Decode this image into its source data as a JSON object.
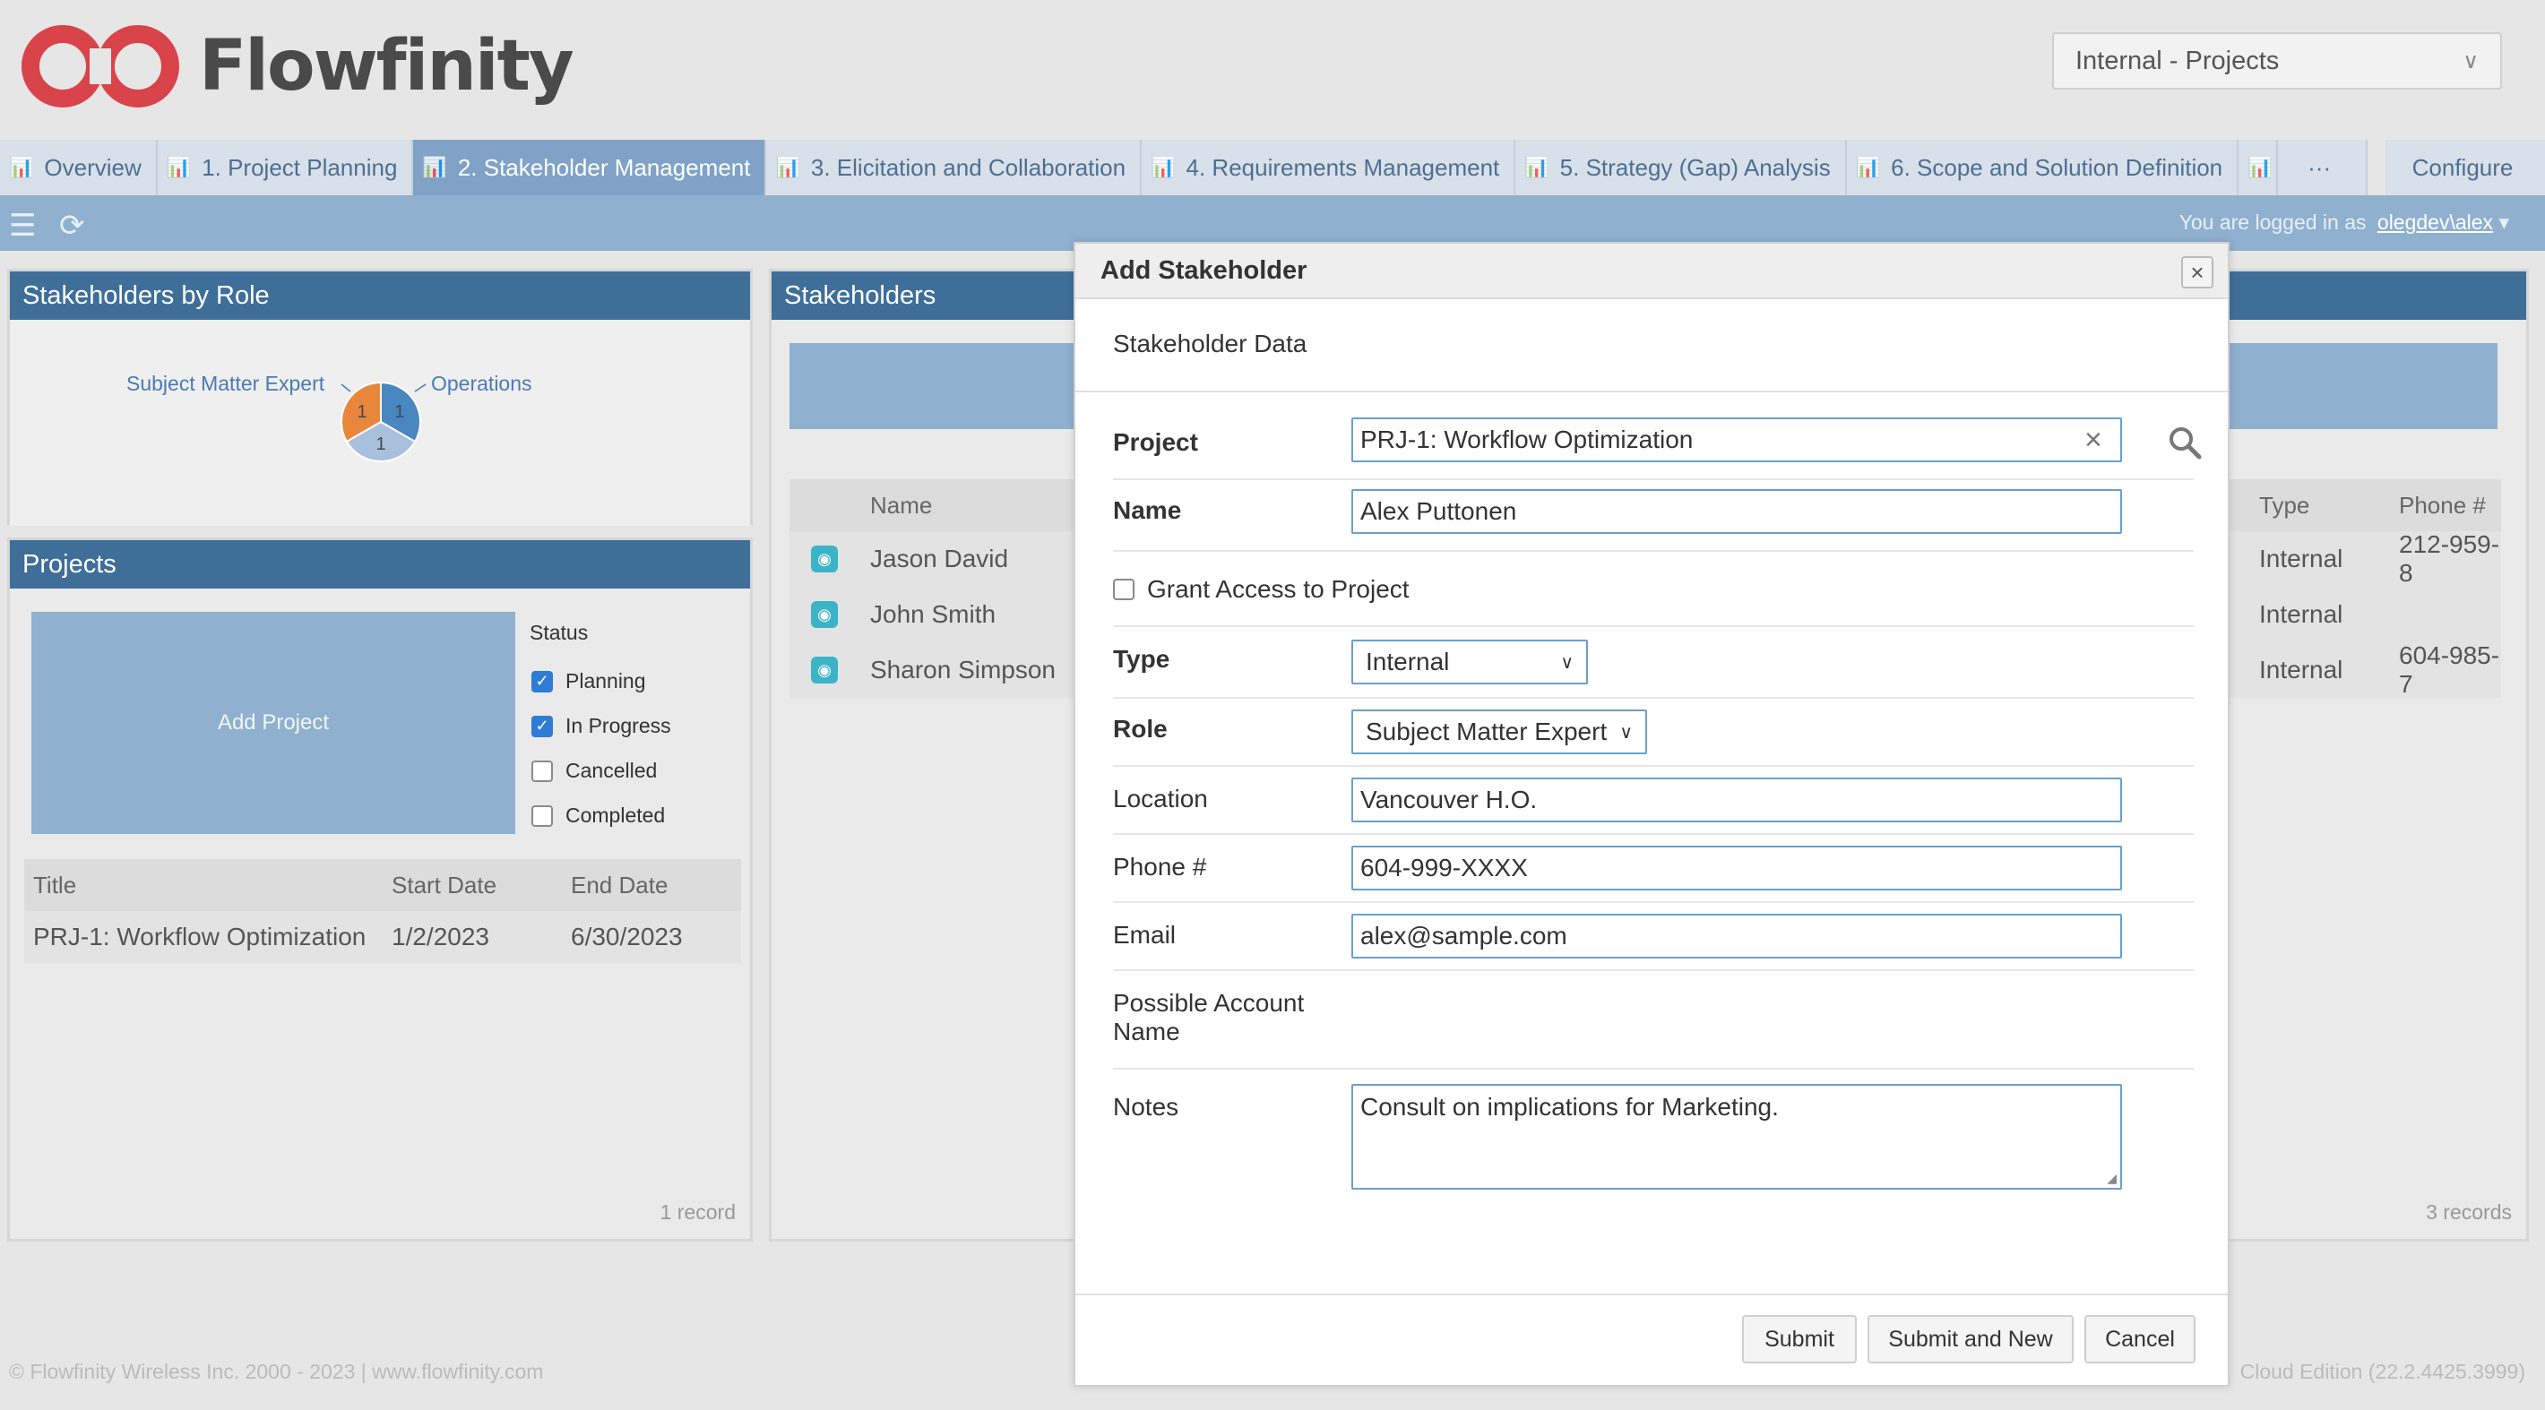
{
  "brand": {
    "name": "Flowfinity",
    "logo_color": "#d9434a"
  },
  "app_select": {
    "value": "Internal - Projects"
  },
  "tabs": [
    {
      "label": "Overview"
    },
    {
      "label": "1. Project Planning"
    },
    {
      "label": "2. Stakeholder Management",
      "active": true
    },
    {
      "label": "3. Elicitation and Collaboration"
    },
    {
      "label": "4. Requirements Management"
    },
    {
      "label": "5. Strategy (Gap) Analysis"
    },
    {
      "label": "6. Scope and Solution Definition"
    }
  ],
  "tabs_more": "···",
  "tabs_configure": "Configure",
  "toolbar": {
    "logged_prefix": "You are logged in as",
    "user": "olegdev\\alex"
  },
  "role_panel": {
    "title": "Stakeholders by Role",
    "chart_data": {
      "type": "pie",
      "slices": [
        {
          "label": "Subject Matter Expert",
          "value": 1,
          "color": "#e8873b"
        },
        {
          "label": "Operations",
          "value": 1,
          "color": "#4a86bf"
        },
        {
          "label": "",
          "value": 1,
          "color": "#a9c0dc"
        }
      ]
    }
  },
  "projects_panel": {
    "title": "Projects",
    "add_label": "Add Project",
    "status_title": "Status",
    "statuses": [
      {
        "label": "Planning",
        "checked": true
      },
      {
        "label": "In Progress",
        "checked": true
      },
      {
        "label": "Cancelled",
        "checked": false
      },
      {
        "label": "Completed",
        "checked": false
      }
    ],
    "columns": [
      "Title",
      "Start Date",
      "End Date"
    ],
    "rows": [
      {
        "title": "PRJ-1: Workflow Optimization",
        "start": "1/2/2023",
        "end": "6/30/2023"
      }
    ],
    "record_count": "1 record"
  },
  "stakeholders_panel": {
    "title": "Stakeholders",
    "columns": {
      "name": "Name",
      "type": "Type",
      "phone": "Phone #"
    },
    "rows": [
      {
        "name": "Jason David",
        "type": "Internal",
        "phone": "212-959-8"
      },
      {
        "name": "John Smith",
        "type": "Internal",
        "phone": ""
      },
      {
        "name": "Sharon Simpson",
        "type": "Internal",
        "phone": "604-985-7"
      }
    ],
    "record_count": "3 records"
  },
  "footer": {
    "copyright": "© Flowfinity Wireless Inc. 2000 - 2023 | www.flowfinity.com",
    "edition": "Cloud Edition (22.2.4425.3999)"
  },
  "modal": {
    "title": "Add Stakeholder",
    "section": "Stakeholder Data",
    "project_label": "Project",
    "project_value": "PRJ-1: Workflow Optimization",
    "name_label": "Name",
    "name_value": "Alex Puttonen",
    "grant_label": "Grant Access to Project",
    "grant_checked": false,
    "type_label": "Type",
    "type_value": "Internal",
    "role_label": "Role",
    "role_value": "Subject Matter Expert",
    "location_label": "Location",
    "location_value": "Vancouver H.O.",
    "phone_label": "Phone #",
    "phone_value": "604-999-XXXX",
    "email_label": "Email",
    "email_value": "alex@sample.com",
    "account_label_line1": "Possible Account",
    "account_label_line2": "Name",
    "notes_label": "Notes",
    "notes_value": "Consult on implications for Marketing.",
    "submit": "Submit",
    "submit_new": "Submit and New",
    "cancel": "Cancel"
  }
}
